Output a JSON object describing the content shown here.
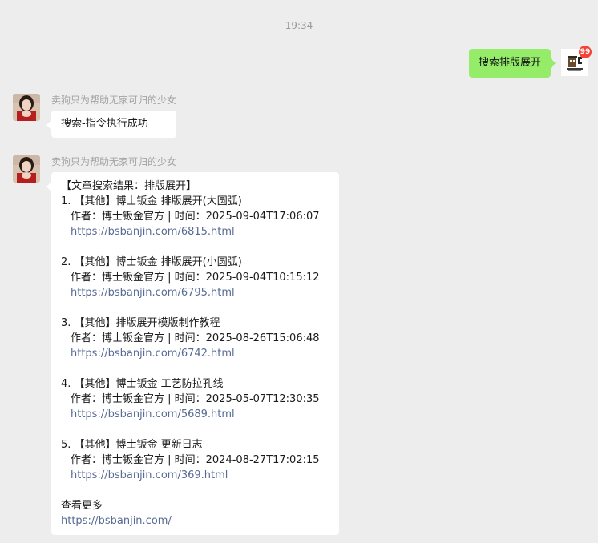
{
  "timestamp": "19:34",
  "outgoing": {
    "text": "搜索排版展开",
    "unread_badge": "99",
    "bubble_color": "#95ec69"
  },
  "sender_name": "卖狗只为帮助无家可归的少女",
  "messages": [
    {
      "text": "搜索-指令执行成功"
    },
    {
      "header": "【文章搜索结果：排版展开】",
      "items": [
        {
          "title": "1. 【其他】博士钣金 排版展开(大圆弧)",
          "meta": "作者：博士钣金官方 | 时间：2025-09-04T17:06:07",
          "url": "https://bsbanjin.com/6815.html"
        },
        {
          "title": "2. 【其他】博士钣金 排版展开(小圆弧)",
          "meta": "作者：博士钣金官方 | 时间：2025-09-04T10:15:12",
          "url": "https://bsbanjin.com/6795.html"
        },
        {
          "title": "3. 【其他】排版展开模版制作教程",
          "meta": "作者：博士钣金官方 | 时间：2025-08-26T15:06:48",
          "url": "https://bsbanjin.com/6742.html"
        },
        {
          "title": "4. 【其他】博士钣金  工艺防拉孔线",
          "meta": "作者：博士钣金官方 | 时间：2025-05-07T12:30:35",
          "url": "https://bsbanjin.com/5689.html"
        },
        {
          "title": "5. 【其他】博士钣金 更新日志",
          "meta": "作者：博士钣金官方 | 时间：2024-08-27T17:02:15",
          "url": "https://bsbanjin.com/369.html"
        }
      ],
      "more_label": "查看更多",
      "more_url": "https://bsbanjin.com/"
    }
  ],
  "colors": {
    "background": "#ededed",
    "link": "#576b95",
    "badge": "#f44336"
  }
}
